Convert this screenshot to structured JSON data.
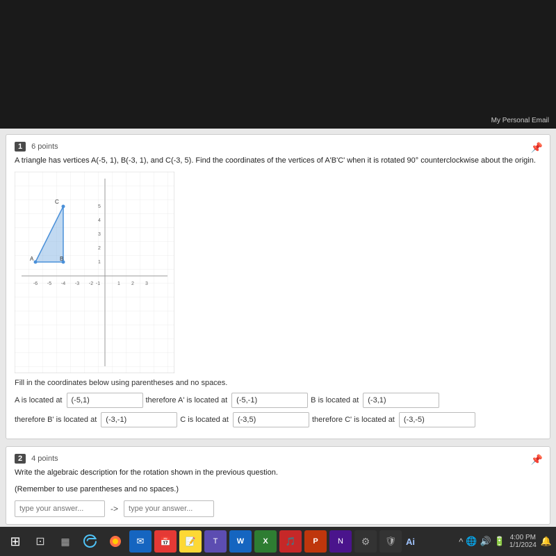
{
  "topbar": {
    "email_label": "My Personal Email"
  },
  "question1": {
    "number": "1",
    "points": "6 points",
    "text": "A triangle has vertices A(-5, 1), B(-3, 1), and C(-3, 5). Find the coordinates of the vertices of A'B'C' when it is rotated 90° counterclockwise about the origin.",
    "fill_label": "Fill in the coordinates below using parentheses and no spaces.",
    "a_label": "A is located at",
    "a_value": "(-5,1)",
    "a_prime_label": "therefore A' is located at",
    "a_prime_value": "(-5,-1)",
    "b_label": "B is located at",
    "b_value": "(-3,1)",
    "b_prime_label": "therefore B' is located at",
    "b_prime_value": "(-3,-1)",
    "c_label": "C is located at",
    "c_value": "(-3,5)",
    "c_prime_label": "therefore C' is located at",
    "c_prime_value": "(-3,-5)"
  },
  "question2": {
    "number": "2",
    "points": "4 points",
    "text": "Write the algebraic description for the rotation shown in the previous question.",
    "subtext": "(Remember to use parentheses and no spaces.)",
    "input1_placeholder": "type your answer...",
    "arrow": "->",
    "input2_placeholder": "type your answer..."
  },
  "taskbar": {
    "ai_label": "Ai",
    "time": "4:0",
    "date": "1/1"
  }
}
